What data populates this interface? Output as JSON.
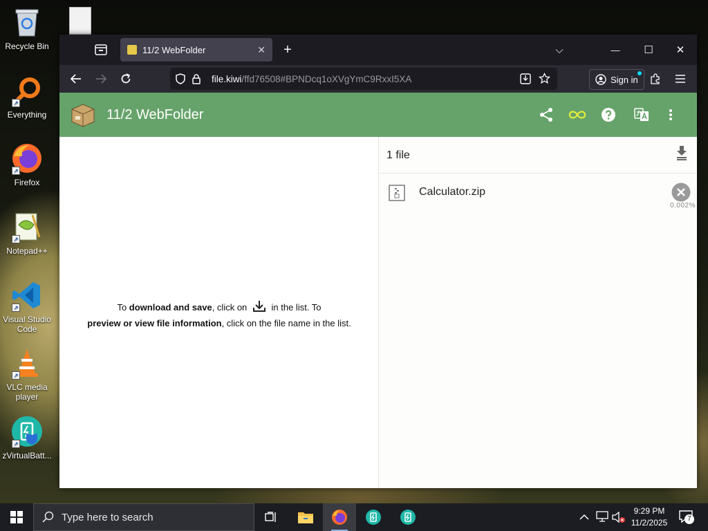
{
  "desktop": {
    "icons": [
      {
        "label": "Recycle Bin"
      },
      {
        "label": "Everything"
      },
      {
        "label": "Firefox"
      },
      {
        "label": "Notepad++"
      },
      {
        "label": "Visual Studio Code"
      },
      {
        "label": "VLC media player"
      },
      {
        "label": "zVirtualBatt..."
      }
    ]
  },
  "browser": {
    "tab": {
      "title": "11/2 WebFolder",
      "close": "✕",
      "new_tab": "+"
    },
    "window_controls": {
      "list_all_tabs": "⌵",
      "minimize": "—",
      "maximize": "☐",
      "close": "✕"
    },
    "url": {
      "host": "file.kiwi",
      "path": "/ffd76508#BPNDcq1oXVgYmC9RxxI5XA"
    },
    "sign_in": "Sign in"
  },
  "app": {
    "title": "11/2 WebFolder",
    "colors": {
      "header": "#66a36a",
      "infinity": "#e6ef3c"
    },
    "hint": {
      "to": "To ",
      "bold1": "download and save",
      "mid": ", click on",
      "after_icon": " in the list. To",
      "bold2": "preview or view file information",
      "end": ", click on the file name in the list."
    },
    "file_list": {
      "count": "1 file",
      "files": [
        {
          "name": "Calculator.zip",
          "progress_text": "0.002%"
        }
      ]
    }
  },
  "taskbar": {
    "search_placeholder": "Type here to search",
    "time": "9:29 PM",
    "date": "11/2/2025",
    "notification_count": "7"
  }
}
